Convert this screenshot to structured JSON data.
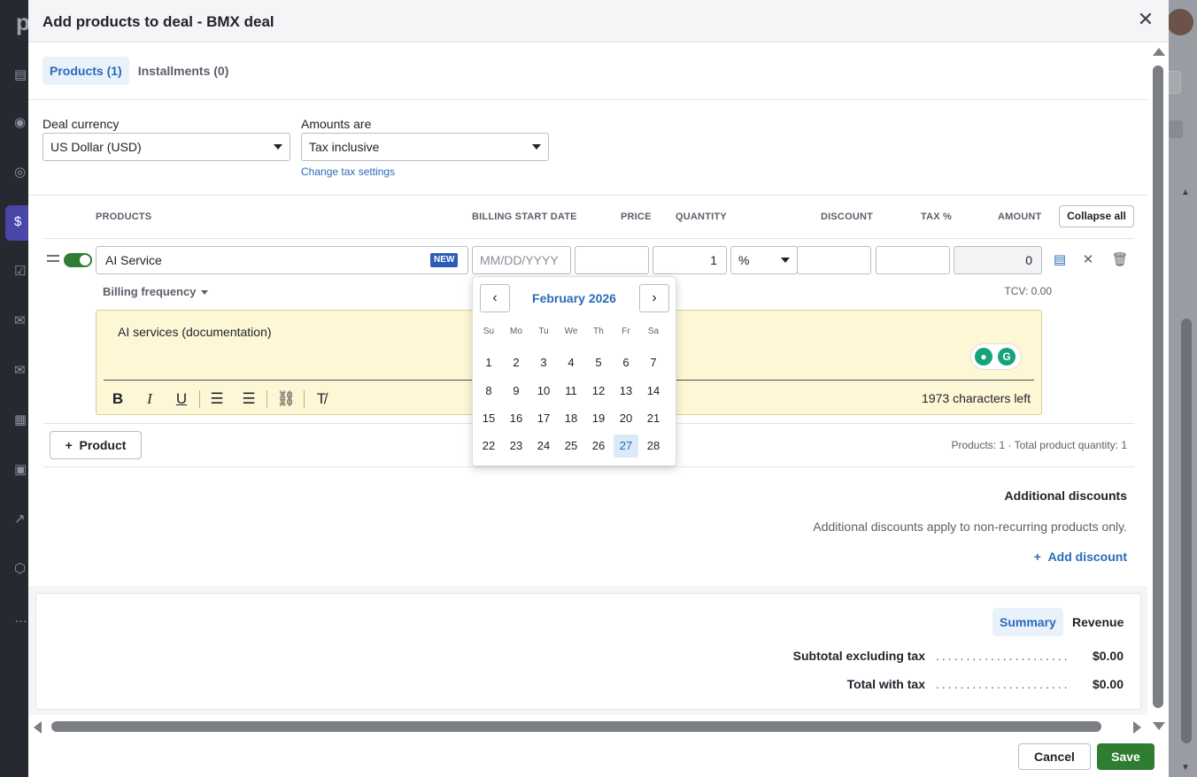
{
  "background": {
    "rail_logo": "p"
  },
  "modal": {
    "title": "Add products to deal - BMX deal",
    "close_icon": "close-icon"
  },
  "tabs": [
    {
      "label": "Products (1)",
      "active": true
    },
    {
      "label": "Installments (0)",
      "active": false
    }
  ],
  "deal_currency": {
    "label": "Deal currency",
    "value": "US Dollar (USD)"
  },
  "amounts_are": {
    "label": "Amounts are",
    "value": "Tax inclusive",
    "change_link": "Change tax settings"
  },
  "columns": {
    "products": "PRODUCTS",
    "billing_start_date": "BILLING START DATE",
    "price": "PRICE",
    "quantity": "QUANTITY",
    "discount": "DISCOUNT",
    "tax": "TAX %",
    "amount": "AMOUNT",
    "collapse_all": "Collapse all"
  },
  "product_row": {
    "name": "AI Service",
    "badge": "NEW",
    "billing_start_placeholder": "MM/DD/YYYY",
    "price": "",
    "quantity": "1",
    "discount_type": "%",
    "discount": "",
    "tax": "",
    "amount": "0",
    "billing_frequency": "Billing frequency",
    "tcv": "TCV: 0.00",
    "description": "AI services (documentation)",
    "chars_left": "1973 characters left"
  },
  "add_product": "Product",
  "products_summary": "Products: 1  ·  Total product quantity: 1",
  "additional_discounts": {
    "title": "Additional discounts",
    "note": "Additional discounts apply to non-recurring products only.",
    "add_link": "Add discount"
  },
  "summary": {
    "tabs": [
      {
        "label": "Summary",
        "active": true
      },
      {
        "label": "Revenue",
        "active": false
      }
    ],
    "subtotal_label": "Subtotal excluding tax",
    "subtotal_value": "$0.00",
    "total_label": "Total with tax",
    "total_value": "$0.00",
    "dots": "......................"
  },
  "footer": {
    "cancel": "Cancel",
    "save": "Save"
  },
  "calendar": {
    "title": "February 2026",
    "dow": [
      "Su",
      "Mo",
      "Tu",
      "We",
      "Th",
      "Fr",
      "Sa"
    ],
    "weeks": [
      [
        "1",
        "2",
        "3",
        "4",
        "5",
        "6",
        "7"
      ],
      [
        "8",
        "9",
        "10",
        "11",
        "12",
        "13",
        "14"
      ],
      [
        "15",
        "16",
        "17",
        "18",
        "19",
        "20",
        "21"
      ],
      [
        "22",
        "23",
        "24",
        "25",
        "26",
        "27",
        "28"
      ]
    ],
    "today": "27"
  }
}
